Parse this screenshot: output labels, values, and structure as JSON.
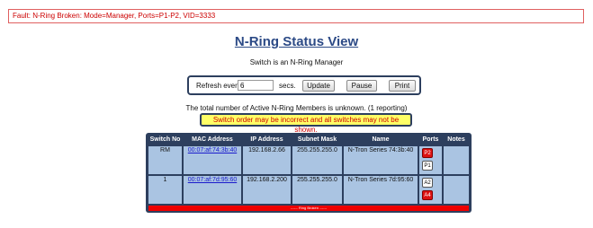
{
  "fault": {
    "text": "Fault:  N-Ring Broken: Mode=Manager, Ports=P1-P2, VID=3333"
  },
  "title": "N-Ring Status View",
  "subtitle": "Switch is an N-Ring Manager",
  "refresh": {
    "label": "Refresh every:",
    "value": "6",
    "unit": "secs."
  },
  "buttons": {
    "update": "Update",
    "pause": "Pause",
    "print": "Print"
  },
  "members_text": "The total number of Active N-Ring Members is unknown. (1 reporting)",
  "warning_text": "Switch order may be incorrect and all switches may not be shown.",
  "table": {
    "headers": [
      "Switch No",
      "MAC Address",
      "IP Address",
      "Subnet Mask",
      "Name",
      "Ports",
      "Notes"
    ],
    "rows": [
      {
        "switch_no": "RM",
        "mac": "00:07:af:74:3b:40",
        "ip": "192.168.2.66",
        "mask": "255.255.255.0",
        "name": "N-Tron Series 74:3b:40",
        "ports": [
          {
            "label": "P2",
            "color": "#dd1111"
          },
          {
            "label": "P1",
            "color": "#ffffff"
          }
        ],
        "notes": ""
      },
      {
        "switch_no": "1",
        "mac": "00:07:af:7d:95:60",
        "ip": "192.168.2.200",
        "mask": "255.255.255.0",
        "name": "N-Tron Series 7d:95:60",
        "ports": [
          {
            "label": "A2",
            "color": "#ffffff"
          },
          {
            "label": "A4",
            "color": "#dd1111"
          }
        ],
        "notes": ""
      }
    ],
    "ring_status": "------ Ring Broken ------"
  }
}
